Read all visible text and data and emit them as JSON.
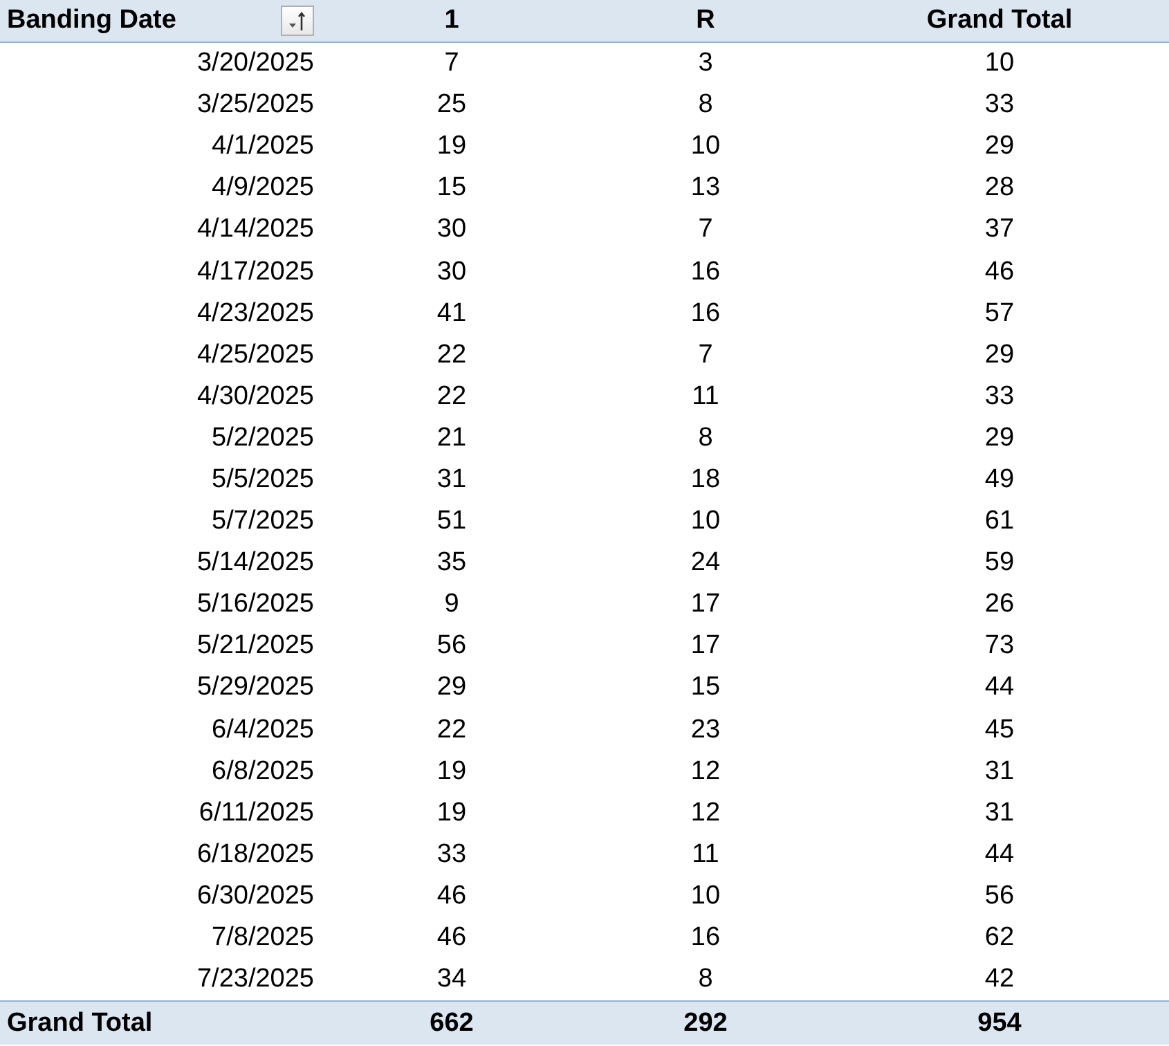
{
  "table": {
    "columns": [
      {
        "label": "Banding Date",
        "filter_button": true
      },
      {
        "label": "1",
        "filter_button": false
      },
      {
        "label": "R",
        "filter_button": false
      },
      {
        "label": "Grand Total",
        "filter_button": false
      }
    ],
    "rows": [
      [
        "3/20/2025",
        "7",
        "3",
        "10"
      ],
      [
        "3/25/2025",
        "25",
        "8",
        "33"
      ],
      [
        "4/1/2025",
        "19",
        "10",
        "29"
      ],
      [
        "4/9/2025",
        "15",
        "13",
        "28"
      ],
      [
        "4/14/2025",
        "30",
        "7",
        "37"
      ],
      [
        "4/17/2025",
        "30",
        "16",
        "46"
      ],
      [
        "4/23/2025",
        "41",
        "16",
        "57"
      ],
      [
        "4/25/2025",
        "22",
        "7",
        "29"
      ],
      [
        "4/30/2025",
        "22",
        "11",
        "33"
      ],
      [
        "5/2/2025",
        "21",
        "8",
        "29"
      ],
      [
        "5/5/2025",
        "31",
        "18",
        "49"
      ],
      [
        "5/7/2025",
        "51",
        "10",
        "61"
      ],
      [
        "5/14/2025",
        "35",
        "24",
        "59"
      ],
      [
        "5/16/2025",
        "9",
        "17",
        "26"
      ],
      [
        "5/21/2025",
        "56",
        "17",
        "73"
      ],
      [
        "5/29/2025",
        "29",
        "15",
        "44"
      ],
      [
        "6/4/2025",
        "22",
        "23",
        "45"
      ],
      [
        "6/8/2025",
        "19",
        "12",
        "31"
      ],
      [
        "6/11/2025",
        "19",
        "12",
        "31"
      ],
      [
        "6/18/2025",
        "33",
        "11",
        "44"
      ],
      [
        "6/30/2025",
        "46",
        "10",
        "56"
      ],
      [
        "7/8/2025",
        "46",
        "16",
        "62"
      ],
      [
        "7/23/2025",
        "34",
        "8",
        "42"
      ]
    ],
    "grand_total": [
      "Grand Total",
      "662",
      "292",
      "954"
    ]
  }
}
